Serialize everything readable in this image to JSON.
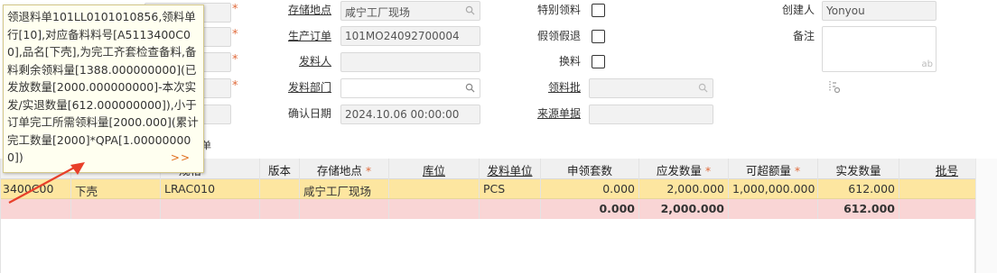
{
  "form": {
    "storage_location_label": "存储地点",
    "storage_location_value": "咸宁工厂现场",
    "special_issue_label": "特别领料",
    "creator_label": "创建人",
    "creator_value": "Yonyou",
    "production_order_label": "生产订单",
    "production_order_value": "101MO24092700004",
    "fake_return_label": "假领假退",
    "remarks_label": "备注",
    "remarks_placeholder": "ab",
    "issuer_label": "发料人",
    "exchange_label": "换料",
    "issue_dept_label": "发料部门",
    "issue_batch_label": "领料批",
    "confirm_date_label": "确认日期",
    "confirm_date_value": "2024.10.06 00:00:00",
    "source_doc_label": "来源单据",
    "partial_tab_text": "单"
  },
  "tooltip": {
    "text": "领退料单101LL0101010856,领料单行[10],对应备料料号[A5113400C00],品名[下壳],为完工齐套检查备料,备料剩余领料量[1388.000000000](已发放数量[2000.000000000]-本次实发/实退数量[612.000000000]),小于订单完工所需领料量[2000.000](累计完工数量[2000]*QPA[1.000000000])",
    "more": ">>"
  },
  "table": {
    "headers": {
      "spec": "规格",
      "version": "版本",
      "storage": "存储地点",
      "bin": "库位",
      "unit": "发料单位",
      "sets": "申领套数",
      "due_qty": "应发数量",
      "over_qty": "可超额量",
      "actual_qty": "实发数量",
      "lot": "批号"
    },
    "row": {
      "item_code_partial": "3400C00",
      "item_name": "下壳",
      "spec": "LRAC010",
      "version": "",
      "storage": "咸宁工厂现场",
      "bin": "",
      "unit": "PCS",
      "sets": "0.000",
      "due_qty": "2,000.000",
      "over_qty": "1,000,000.000",
      "actual_qty": "612.000",
      "lot": ""
    },
    "total": {
      "sets": "0.000",
      "due_qty": "2,000.000",
      "actual_qty": "612.000"
    }
  },
  "colors": {
    "selected_row": "#fde6a0",
    "total_row": "#f9d5d5",
    "required_star": "#e06a3b",
    "arrow": "#e8402a"
  }
}
